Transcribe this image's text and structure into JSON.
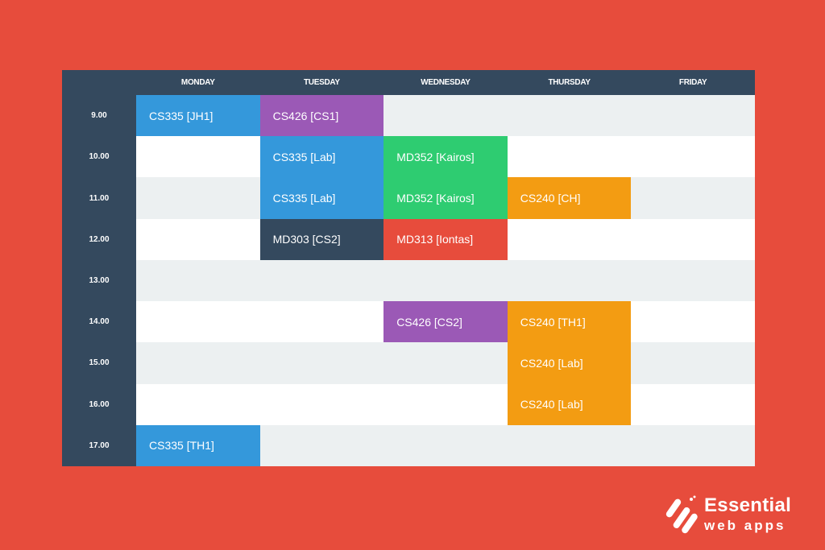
{
  "timetable": {
    "days": [
      "MONDAY",
      "TUESDAY",
      "WEDNESDAY",
      "THURSDAY",
      "FRIDAY"
    ],
    "times": [
      "9.00",
      "10.00",
      "11.00",
      "12.00",
      "13.00",
      "14.00",
      "15.00",
      "16.00",
      "17.00"
    ],
    "sessions": [
      {
        "label": "CS335 [JH1]",
        "day": 0,
        "row": 0,
        "color": "#3498db"
      },
      {
        "label": "CS426 [CS1]",
        "day": 1,
        "row": 0,
        "color": "#9b59b6"
      },
      {
        "label": "CS335 [Lab]",
        "day": 1,
        "row": 1,
        "color": "#3498db"
      },
      {
        "label": "MD352 [Kairos]",
        "day": 2,
        "row": 1,
        "color": "#2ecc71"
      },
      {
        "label": "CS335 [Lab]",
        "day": 1,
        "row": 2,
        "color": "#3498db"
      },
      {
        "label": "MD352 [Kairos]",
        "day": 2,
        "row": 2,
        "color": "#2ecc71"
      },
      {
        "label": "CS240 [CH]",
        "day": 3,
        "row": 2,
        "color": "#f39c12"
      },
      {
        "label": "MD303 [CS2]",
        "day": 1,
        "row": 3,
        "color": "#34495e"
      },
      {
        "label": "MD313 [Iontas]",
        "day": 2,
        "row": 3,
        "color": "#e74c3c"
      },
      {
        "label": "CS426 [CS2]",
        "day": 2,
        "row": 5,
        "color": "#9b59b6"
      },
      {
        "label": "CS240 [TH1]",
        "day": 3,
        "row": 5,
        "color": "#f39c12"
      },
      {
        "label": "CS240 [Lab]",
        "day": 3,
        "row": 6,
        "color": "#f39c12"
      },
      {
        "label": "CS240 [Lab]",
        "day": 3,
        "row": 7,
        "color": "#f39c12"
      },
      {
        "label": "CS335 [TH1]",
        "day": 0,
        "row": 8,
        "color": "#3498db"
      }
    ]
  },
  "brand": {
    "name": "Essential",
    "tagline": "web apps"
  },
  "colors": {
    "background": "#e74c3c",
    "header": "#34495e",
    "row_alt": "#ecf0f1"
  }
}
